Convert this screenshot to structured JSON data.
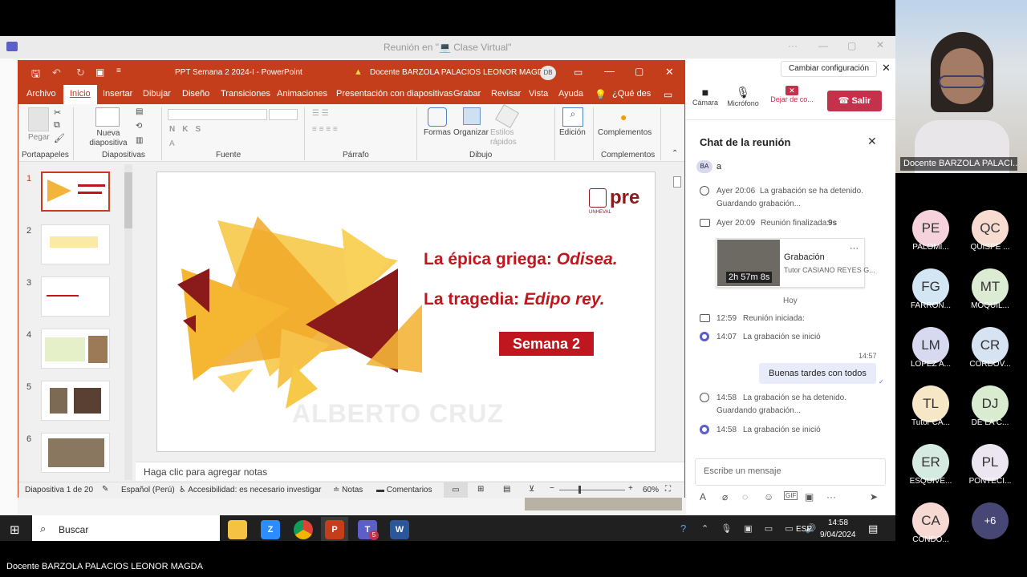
{
  "meeting": {
    "title": "Reunión en \"💻 Clase Virtual\"",
    "change_settings": "Cambiar configuración",
    "controls": {
      "camera": "Cámara",
      "mic": "Micrófono",
      "stop_sharing": "Dejar de co...",
      "leave": "Salir"
    }
  },
  "chat": {
    "title": "Chat de la reunión",
    "top_avatar": "BA",
    "top_text": "a",
    "events": [
      {
        "time": "Ayer 20:06",
        "text": "La grabación se ha detenido.",
        "sub": "Guardando grabación..."
      },
      {
        "time": "Ayer 20:09",
        "text": "Reunión finalizada:",
        "bold": "9s"
      }
    ],
    "recording": {
      "title": "Grabación",
      "author": "Tutor CASIANO REYES G...",
      "duration": "2h 57m 8s",
      "more": "···"
    },
    "today": "Hoy",
    "events2": [
      {
        "time": "12:59",
        "text": "Reunión iniciada:"
      },
      {
        "time": "14:07",
        "text": "La grabación se inició"
      }
    ],
    "msg_time": "14:57",
    "msg_text": "Buenas tardes con todos",
    "events3": [
      {
        "time": "14:58",
        "text": "La grabación se ha detenido.",
        "sub": "Guardando grabación..."
      },
      {
        "time": "14:58",
        "text": "La grabación se inició"
      }
    ],
    "compose_placeholder": "Escribe un mensaje"
  },
  "ppt": {
    "title": "PPT Semana 2 2024-I  -  PowerPoint",
    "warning_user": "Docente BARZOLA PALACIOS LEONOR MAGDA",
    "user_initials": "DB",
    "menu": [
      "Archivo",
      "Inicio",
      "Insertar",
      "Dibujar",
      "Diseño",
      "Transiciones",
      "Animaciones",
      "Presentación con diapositivas",
      "Grabar",
      "Revisar",
      "Vista",
      "Ayuda",
      "¿Qué des"
    ],
    "ribbon": {
      "paste": "Pegar",
      "new_slide": "Nueva diapositiva",
      "shapes": "Formas",
      "arrange": "Organizar",
      "quick_styles": "Estilos rápidos",
      "edit": "Edición",
      "addins": "Complementos",
      "groups": [
        "Portapapeles",
        "Diapositivas",
        "Fuente",
        "Párrafo",
        "Dibujo",
        "Complementos"
      ]
    },
    "thumb_numbers": [
      "1",
      "2",
      "3",
      "4",
      "5",
      "6"
    ],
    "slide": {
      "line1": "La épica griega: ",
      "line1_em": "Odisea.",
      "line2": "La tragedia: ",
      "line2_em": "Edipo rey.",
      "badge": "Semana 2",
      "watermark": "ALBERTO CRUZ",
      "logo": "pre",
      "logo_sub": "UNHEVAL"
    },
    "notes_placeholder": "Haga clic para agregar notas",
    "status": {
      "slide": "Diapositiva 1 de 20",
      "lang": "Español (Perú)",
      "a11y": "Accesibilidad: es necesario investigar",
      "notes": "Notas",
      "comments": "Comentarios",
      "zoom": "60%"
    }
  },
  "presenter": {
    "name": "Docente BARZOLA PALACI..."
  },
  "participants": [
    {
      "initials": "PE",
      "name": "PALOMI...",
      "color": "#f6d3dc"
    },
    {
      "initials": "QC",
      "name": "QUISPE ...",
      "color": "#f9dcd1"
    },
    {
      "initials": "FG",
      "name": "FARRON...",
      "color": "#d2e6f3"
    },
    {
      "initials": "MT",
      "name": "MOQUIL...",
      "color": "#dcebd3"
    },
    {
      "initials": "LM",
      "name": "LOPEZ A...",
      "color": "#d7d9f1"
    },
    {
      "initials": "CR",
      "name": "CORDOV...",
      "color": "#d6e3f3"
    },
    {
      "initials": "TL",
      "name": "Tutor CA...",
      "color": "#f6e8c7"
    },
    {
      "initials": "DJ",
      "name": "DE LA C...",
      "color": "#d9ecd0"
    },
    {
      "initials": "ER",
      "name": "ESQUIVE...",
      "color": "#d5ebe1"
    },
    {
      "initials": "PL",
      "name": "PONTECI...",
      "color": "#ece6f2"
    },
    {
      "initials": "CA",
      "name": "CONDO...",
      "color": "#f6d9d2"
    },
    {
      "initials": "+6",
      "name": "",
      "color": "#464775"
    }
  ],
  "taskbar": {
    "search": "Buscar",
    "lang": "ESP",
    "time": "14:58",
    "date": "9/04/2024",
    "teams_badge": "5"
  },
  "caption": "Docente BARZOLA PALACIOS LEONOR MAGDA",
  "colors": {
    "ppt_red": "#c43e1c",
    "slide_red": "#c0161d",
    "teams_purple": "#5b5fc7",
    "leave_red": "#c4314b"
  }
}
